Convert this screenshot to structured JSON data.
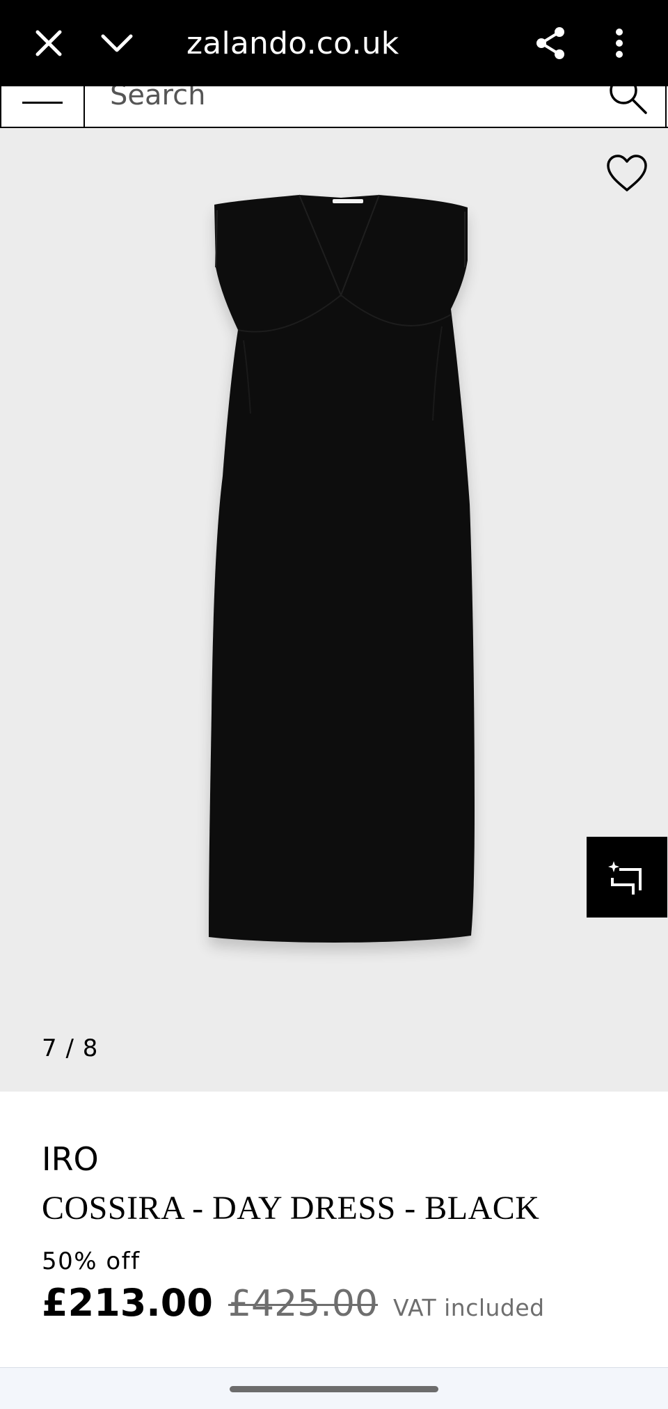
{
  "browser": {
    "url": "zalando.co.uk",
    "icons": {
      "close": "close-icon",
      "collapse": "chevron-down-icon",
      "share": "share-icon",
      "more": "more-vert-icon"
    }
  },
  "search": {
    "placeholder": "Search",
    "icon": "search-icon",
    "menu_icon": "menu-icon"
  },
  "gallery": {
    "counter": "7 / 8",
    "current": 7,
    "total": 8,
    "background": "#ececec",
    "favorite_icon": "heart-icon",
    "crop_icon": "crop-sparkle-icon"
  },
  "product": {
    "brand": "IRO",
    "name": "COSSIRA - DAY DRESS - BLACK",
    "discount": "50% off",
    "price": "£213.00",
    "original_price": "£425.00",
    "vat": "VAT included"
  }
}
